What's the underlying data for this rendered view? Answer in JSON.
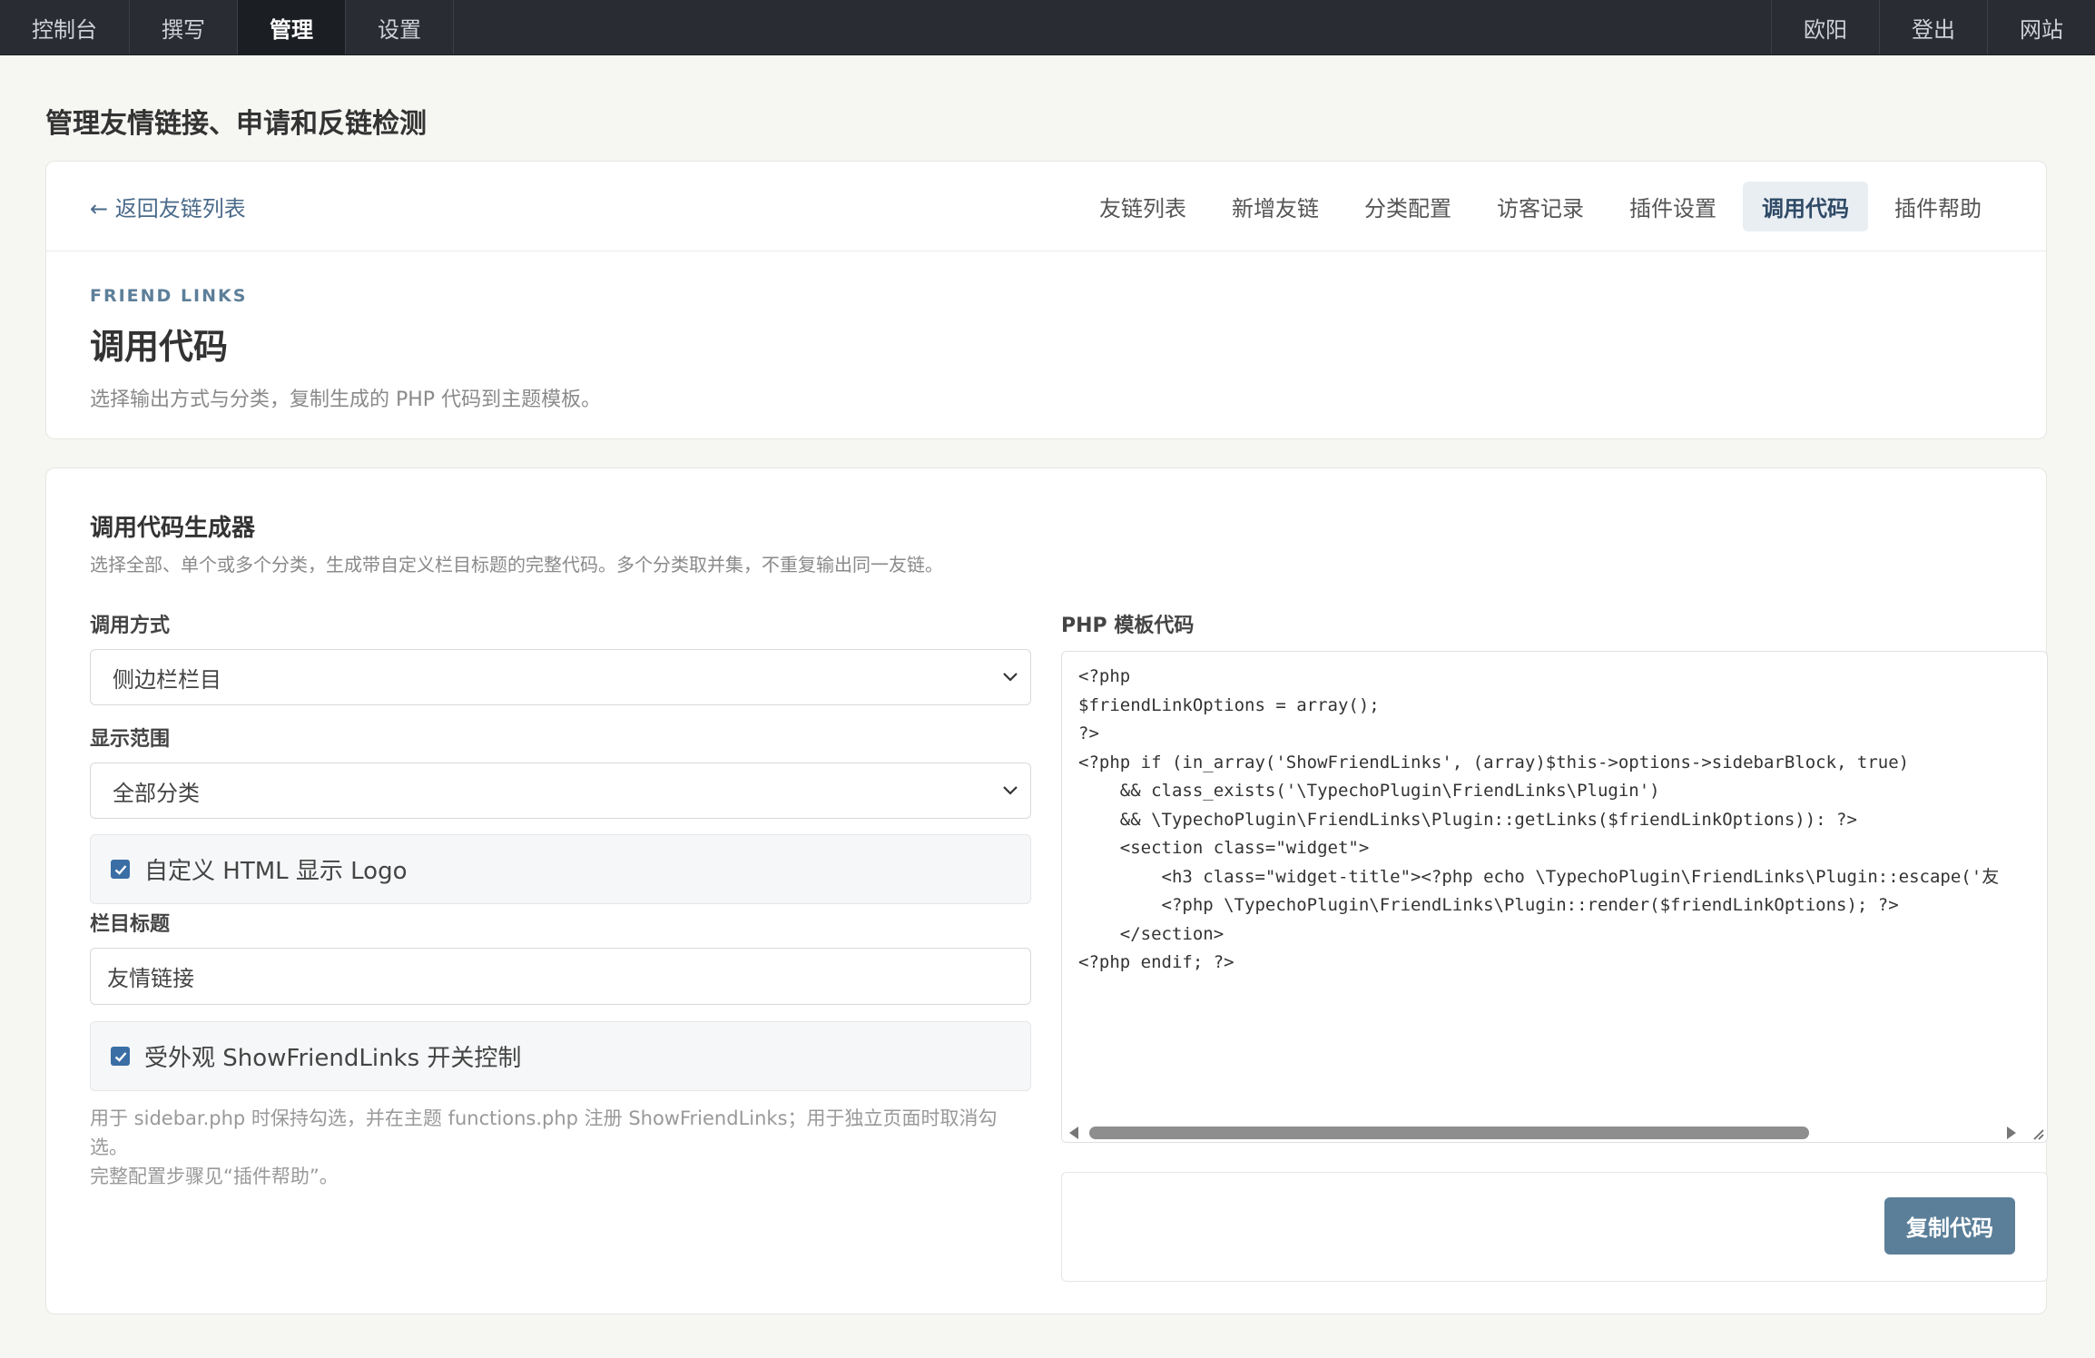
{
  "topnav": {
    "left": [
      "控制台",
      "撰写",
      "管理",
      "设置"
    ],
    "active_index": 2,
    "right": [
      "欧阳",
      "登出",
      "网站"
    ]
  },
  "page_heading": "管理友情链接、申请和反链检测",
  "card_nav": {
    "back_label": "← 返回友链列表",
    "tabs": [
      "友链列表",
      "新增友链",
      "分类配置",
      "访客记录",
      "插件设置",
      "调用代码",
      "插件帮助"
    ],
    "active_tab": "调用代码"
  },
  "hero": {
    "eyebrow": "FRIEND LINKS",
    "title": "调用代码",
    "subtitle": "选择输出方式与分类，复制生成的 PHP 代码到主题模板。"
  },
  "generator": {
    "title": "调用代码生成器",
    "description": "选择全部、单个或多个分类，生成带自定义栏目标题的完整代码。多个分类取并集，不重复输出同一友链。",
    "mode_label": "调用方式",
    "mode_value": "侧边栏栏目",
    "scope_label": "显示范围",
    "scope_value": "全部分类",
    "custom_logo_label": "自定义 HTML 显示 Logo",
    "custom_logo_checked": true,
    "column_title_label": "栏目标题",
    "column_title_value": "友情链接",
    "appearance_label": "受外观 ShowFriendLinks 开关控制",
    "appearance_checked": true,
    "help_line1": "用于 sidebar.php 时保持勾选，并在主题 functions.php 注册 ShowFriendLinks；用于独立页面时取消勾选。",
    "help_line2": "完整配置步骤见“插件帮助”。",
    "code_label": "PHP 模板代码",
    "code": "<?php\n$friendLinkOptions = array();\n?>\n<?php if (in_array('ShowFriendLinks', (array)$this->options->sidebarBlock, true)\n    && class_exists('\\TypechoPlugin\\FriendLinks\\Plugin')\n    && \\TypechoPlugin\\FriendLinks\\Plugin::getLinks($friendLinkOptions)): ?>\n    <section class=\"widget\">\n        <h3 class=\"widget-title\"><?php echo \\TypechoPlugin\\FriendLinks\\Plugin::escape('友\n        <?php \\TypechoPlugin\\FriendLinks\\Plugin::render($friendLinkOptions); ?>\n    </section>\n<?php endif; ?>",
    "copy_button": "复制代码"
  },
  "colors": {
    "topbar": "#292d33",
    "accent": "#5b7f99",
    "checkbox": "#3a6ea5"
  }
}
